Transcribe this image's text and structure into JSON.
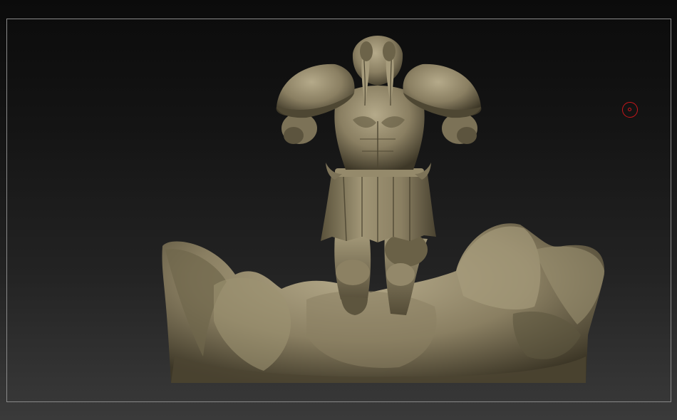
{
  "app": {
    "background_top": "#0b0b0b",
    "background_bottom": "#3a3a3a"
  },
  "document": {
    "frame_color": "#8a8a8a"
  },
  "model": {
    "material_color": "#8a7f62",
    "shadow_color": "#3d3727",
    "highlight_color": "#b5aa8a"
  },
  "cursor": {
    "icon": "brush-cursor-icon",
    "color": "#c8161b"
  }
}
